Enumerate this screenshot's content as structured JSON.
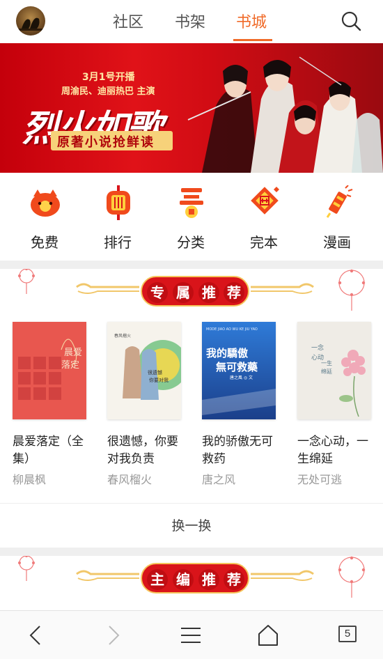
{
  "header": {
    "tabs": [
      {
        "label": "社区"
      },
      {
        "label": "书架"
      },
      {
        "label": "书城",
        "active": true
      }
    ],
    "accent_color": "#f06a28"
  },
  "banner": {
    "date": "3月1号开播",
    "cast": "周渝民、迪丽热巴 主演",
    "title": "烈火如歌",
    "subtitle": "原著小说抢鲜读",
    "background_color": "#d10c14",
    "slide_count": 4,
    "active_slide": 1
  },
  "categories": [
    {
      "label": "免费",
      "icon": "free-icon"
    },
    {
      "label": "排行",
      "icon": "ranking-icon"
    },
    {
      "label": "分类",
      "icon": "category-icon"
    },
    {
      "label": "完本",
      "icon": "completed-icon"
    },
    {
      "label": "漫画",
      "icon": "comic-icon"
    }
  ],
  "section_exclusive": {
    "chars": [
      "专",
      "属",
      "推",
      "荐"
    ]
  },
  "books": [
    {
      "title": "晨爱落定（全集）",
      "author": "柳晨枫",
      "cover_color": "#e5544f",
      "cover_text": "晨爱落定"
    },
    {
      "title": "很遗憾，你要对我负责",
      "author": "春风榴火",
      "cover_color": "#f4f0e8",
      "cover_text": "很遗憾你要对我负责"
    },
    {
      "title": "我的骄傲无可救药",
      "author": "唐之风",
      "cover_color": "#2f6dc4",
      "cover_text": "我的驕傲無可救藥"
    },
    {
      "title": "一念心动，一生绵延",
      "author": "无处可逃",
      "cover_color": "#efece6",
      "cover_text": "一念心动一生绵延"
    }
  ],
  "refresh_label": "换一换",
  "section_editor": {
    "chars": [
      "主",
      "编",
      "推",
      "荐"
    ]
  },
  "bottom_nav": {
    "tab_count": "5"
  }
}
